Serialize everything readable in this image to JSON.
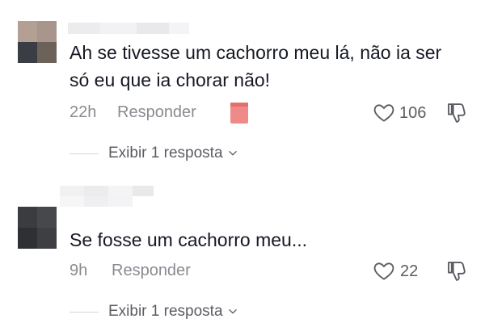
{
  "comments": [
    {
      "text": "Ah se tivesse um cachorro meu lá, não ia ser só eu que ia chorar não!",
      "time": "22h",
      "reply_label": "Responder",
      "likes": "106",
      "view_replies": "Exibir 1 resposta"
    },
    {
      "text": "Se fosse um cachorro meu...",
      "time": "9h",
      "reply_label": "Responder",
      "likes": "22",
      "view_replies": "Exibir 1 resposta"
    }
  ],
  "icons": {
    "like": "heart-outline-icon",
    "dislike": "thumbs-down-outline-icon",
    "expand": "chevron-down-icon"
  },
  "colors": {
    "text": "#161823",
    "meta": "#8a8b91",
    "badge": "#f08a88"
  }
}
